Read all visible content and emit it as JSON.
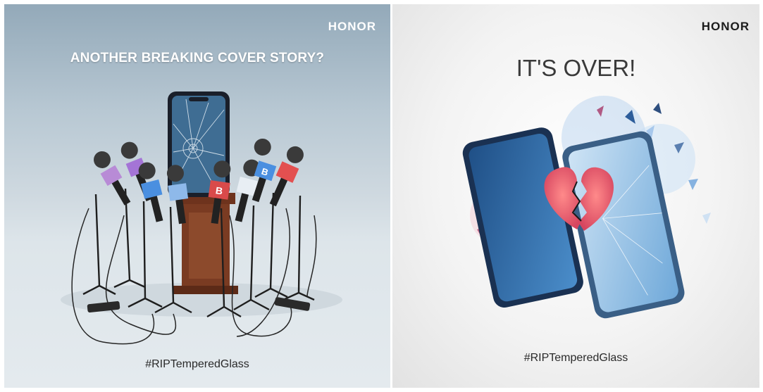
{
  "left_ad": {
    "brand": "HONOR",
    "headline": "ANOTHER BREAKING COVER STORY?",
    "hashtag": "#RIPTemperedGlass",
    "illustration": "cracked-smartphone-on-podium-with-press-microphones"
  },
  "right_ad": {
    "brand": "HONOR",
    "headline": "IT'S OVER!",
    "hashtag": "#RIPTemperedGlass",
    "illustration": "shattering-smartphone-with-broken-heart"
  },
  "colors": {
    "left_background": "#b8c8d3",
    "right_background": "#f3f3f3",
    "podium": "#7a3b22",
    "heart": "#e8526a"
  }
}
